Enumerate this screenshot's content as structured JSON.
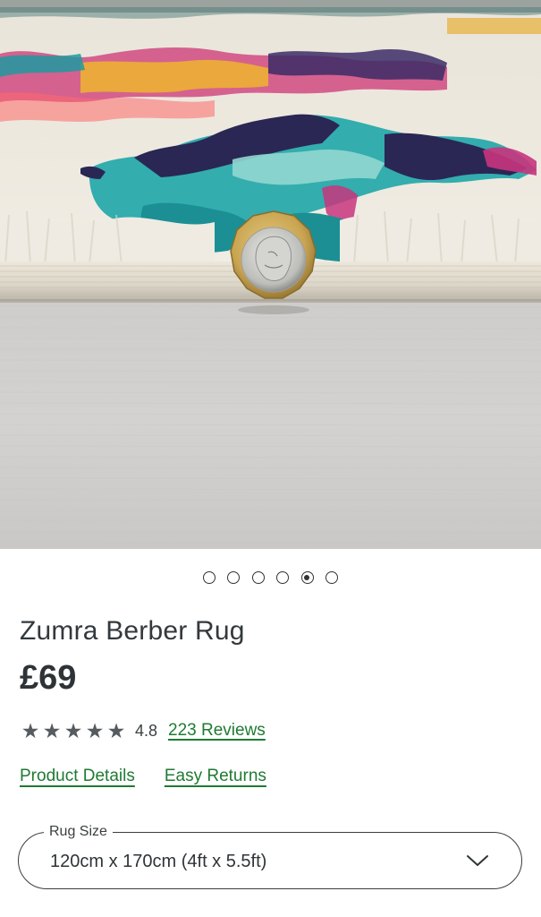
{
  "product": {
    "image_alt": "Close-up of Zumra Berber Rug pile with a coin for scale",
    "title": "Zumra Berber Rug",
    "price": "£69"
  },
  "carousel": {
    "count": 6,
    "active_index": 4
  },
  "rating": {
    "stars": [
      "★",
      "★",
      "★",
      "★",
      "★"
    ],
    "value": "4.8",
    "reviews_label": "223 Reviews"
  },
  "links": {
    "details": "Product Details",
    "returns": "Easy Returns"
  },
  "size_select": {
    "label": "Rug Size",
    "value": "120cm x 170cm (4ft x 5.5ft)"
  },
  "colors": {
    "link_green": "#1f7a33",
    "text_dark": "#2f3437"
  }
}
